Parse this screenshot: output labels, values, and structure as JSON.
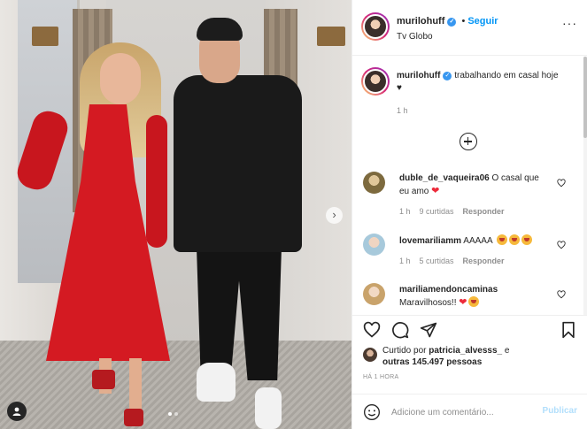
{
  "post": {
    "username": "murilohuff",
    "follow_label": "Seguir",
    "location": "Tv Globo",
    "caption_text": "trabalhando em casal hoje ♥",
    "caption_time": "1 h",
    "carousel": {
      "total": 2,
      "current": 1
    }
  },
  "comments": [
    {
      "user": "duble_de_vaqueira06",
      "text": "O casal que eu amo",
      "emojis": [
        "red-heart"
      ],
      "time": "1 h",
      "likes": "9 curtidas",
      "reply": "Responder",
      "avatar_color": "#8a7a4a"
    },
    {
      "user": "lovemariliamm",
      "text": "AAAAA",
      "emojis": [
        "star-struck",
        "star-struck",
        "star-struck"
      ],
      "time": "1 h",
      "likes": "5 curtidas",
      "reply": "Responder",
      "avatar_color": "#9fc5d9"
    },
    {
      "user": "mariliamendoncaminas",
      "text": "Maravilhosos!!",
      "emojis": [
        "red-heart",
        "heart-eyes"
      ],
      "time": "",
      "likes": "",
      "reply": "",
      "avatar_color": "#d8b48a"
    }
  ],
  "actions": {
    "liked_by_prefix": "Curtido por",
    "liked_by_user": "patricia_alvesss_",
    "liked_by_joiner": "e",
    "liked_by_others": "outras 145.497 pessoas",
    "post_time": "HÁ 1 HORA",
    "comment_placeholder": "Adicione um comentário...",
    "publish_label": "Publicar"
  },
  "colors": {
    "link_blue": "#0095f6",
    "publish_disabled": "#b2dffc",
    "verified_blue": "#3897f0",
    "heart_red": "#ed2b3b"
  },
  "icons": [
    "heart-icon",
    "comment-icon",
    "share-icon",
    "bookmark-icon",
    "emoji-icon",
    "more-options-icon",
    "load-more-icon",
    "carousel-next-icon",
    "tagged-users-icon",
    "verified-badge-icon"
  ]
}
